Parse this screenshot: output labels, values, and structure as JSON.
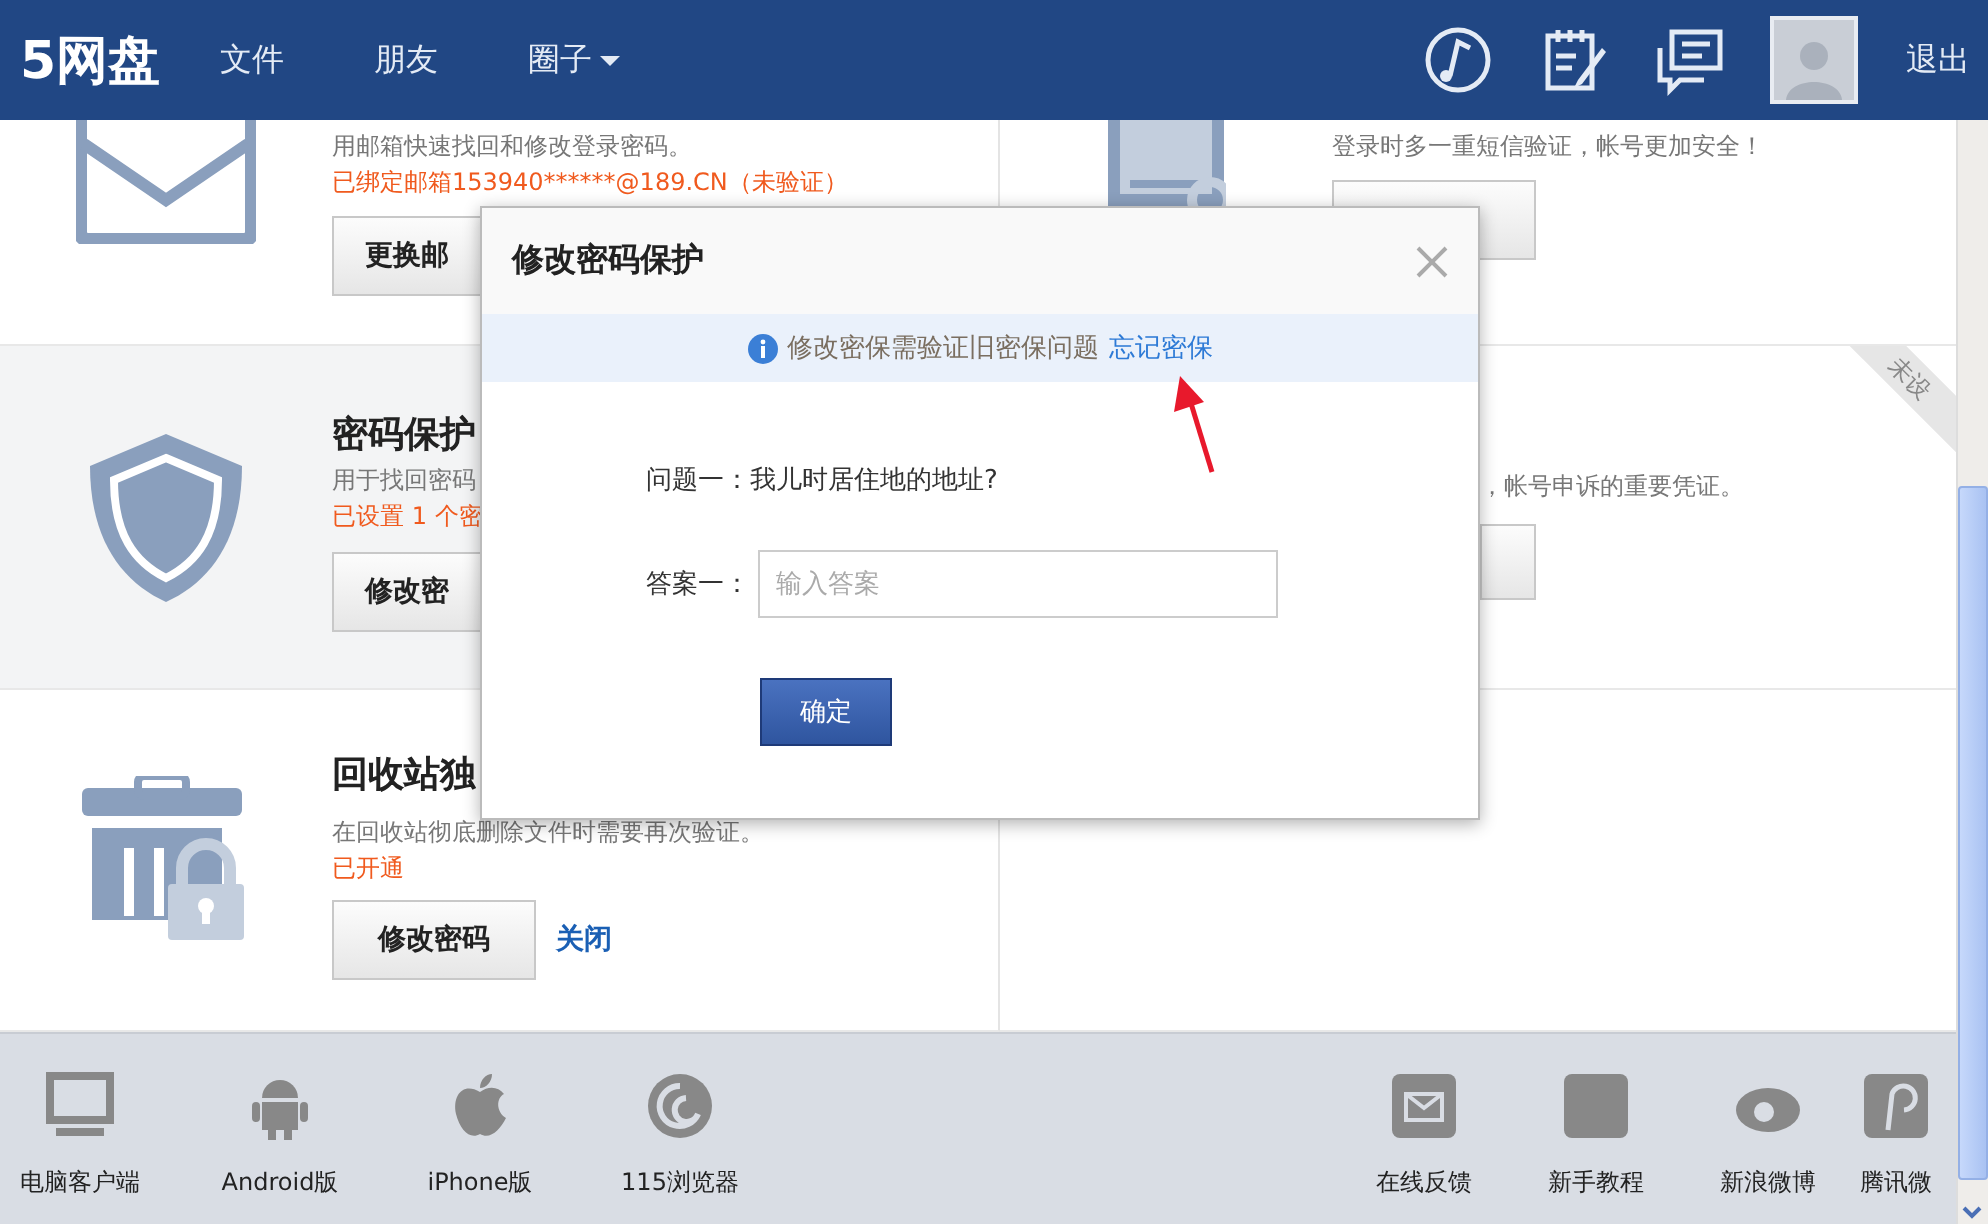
{
  "header": {
    "logo": "5网盘",
    "nav": [
      {
        "label": "文件",
        "dropdown": false
      },
      {
        "label": "朋友",
        "dropdown": false
      },
      {
        "label": "圈子",
        "dropdown": true
      }
    ],
    "logout": "退出"
  },
  "cards": [
    {
      "kind": "mail",
      "highlighted": false,
      "description": "用邮箱快速找回和修改登录密码。",
      "status": "已绑定邮箱153940******@189.CN（未验证）",
      "button": "更换邮"
    },
    {
      "kind": "phone",
      "highlighted": false,
      "description": "登录时多一重短信验证，帐号更加安全！"
    },
    {
      "kind": "shield",
      "highlighted": true,
      "title": "密码保护",
      "description": "用于找回密码",
      "status": "已设置 1 个密",
      "button": "修改密"
    },
    {
      "kind": "plain",
      "highlighted": false,
      "ribbon": "未设",
      "description": "，帐号申诉的重要凭证。"
    },
    {
      "kind": "trash",
      "highlighted": false,
      "title": "回收站独",
      "description": "在回收站彻底删除文件时需要再次验证。",
      "status": "已开通",
      "button": "修改密码",
      "link": "关闭"
    },
    {
      "kind": "empty",
      "highlighted": false
    }
  ],
  "footer": {
    "left": [
      {
        "kind": "monitor",
        "label": "电脑客户端"
      },
      {
        "kind": "android",
        "label": "Android版"
      },
      {
        "kind": "apple",
        "label": "iPhone版"
      },
      {
        "kind": "swirl",
        "label": "115浏览器"
      }
    ],
    "right": [
      {
        "kind": "mail",
        "label": "在线反馈"
      },
      {
        "kind": "tile",
        "label": "新手教程"
      },
      {
        "kind": "eye",
        "label": "新浪微博"
      },
      {
        "kind": "curl",
        "label": "腾讯微"
      }
    ]
  },
  "dialog": {
    "title": "修改密码保护",
    "notice": "修改密保需验证旧密保问题",
    "notice_link": "忘记密保",
    "question": "问题一：我儿时居住地的地址?",
    "answer_label": "答案一：",
    "answer_placeholder": "输入答案",
    "submit": "确定"
  }
}
